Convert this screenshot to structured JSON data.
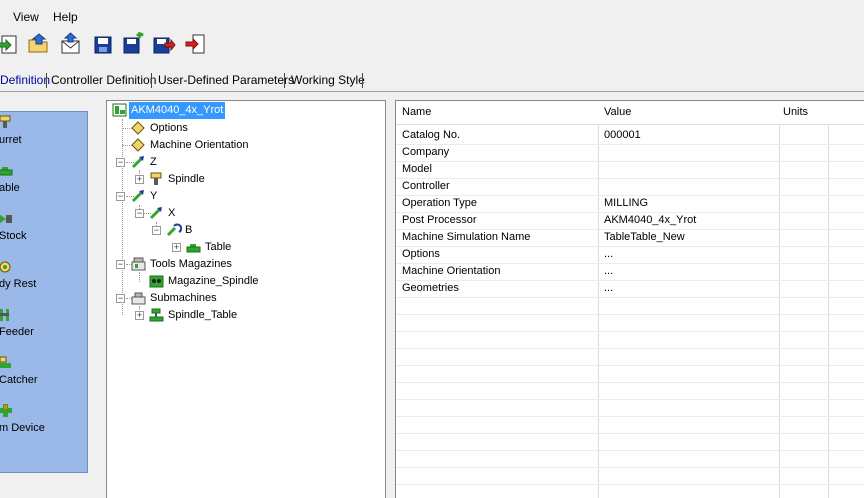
{
  "menu": {
    "items": [
      "View",
      "Help"
    ]
  },
  "toolbar": {
    "buttons": [
      "new-machine-icon",
      "open-folder-icon",
      "import-icon",
      "save-icon",
      "save-as-icon",
      "save-export-icon",
      "exit-icon"
    ]
  },
  "tabs": {
    "items": [
      "Definition",
      "Controller Definition",
      "User-Defined Parameters",
      "Working Style"
    ],
    "active_index": 0,
    "active_color": "#0000a0"
  },
  "palette": {
    "background": "#9ab8e8",
    "items": [
      {
        "label": "urret",
        "icon": "turret-icon"
      },
      {
        "label": "able",
        "icon": "table-icon"
      },
      {
        "label": " Stock",
        "icon": "stock-icon"
      },
      {
        "label": "dy Rest",
        "icon": "steady-rest-icon"
      },
      {
        "label": " Feeder",
        "icon": "feeder-icon"
      },
      {
        "label": " Catcher",
        "icon": "catcher-icon"
      },
      {
        "label": "m Device",
        "icon": "device-icon"
      }
    ]
  },
  "tree": {
    "root": "AKM4040_4x_Yrot",
    "options": "Options",
    "orientation": "Machine Orientation",
    "z": "Z",
    "spindle": "Spindle",
    "y": "Y",
    "x": "X",
    "b": "B",
    "table": "Table",
    "tools_magazines": "Tools Magazines",
    "magazine_spindle": "Magazine_Spindle",
    "submachines": "Submachines",
    "spindle_table": "Spindle_Table",
    "selection_color": "#3399ff"
  },
  "grid": {
    "headers": {
      "name": "Name",
      "value": "Value",
      "units": "Units"
    },
    "rows": [
      {
        "name": "Catalog No.",
        "value": "000001"
      },
      {
        "name": "Company",
        "value": ""
      },
      {
        "name": "Model",
        "value": ""
      },
      {
        "name": "Controller",
        "value": ""
      },
      {
        "name": "Operation Type",
        "value": "MILLING"
      },
      {
        "name": "Post Processor",
        "value": "AKM4040_4x_Yrot"
      },
      {
        "name": "Machine Simulation Name",
        "value": "TableTable_New"
      },
      {
        "name": "Options",
        "value": "..."
      },
      {
        "name": "Machine Orientation",
        "value": "..."
      },
      {
        "name": "Geometries",
        "value": "..."
      }
    ]
  }
}
